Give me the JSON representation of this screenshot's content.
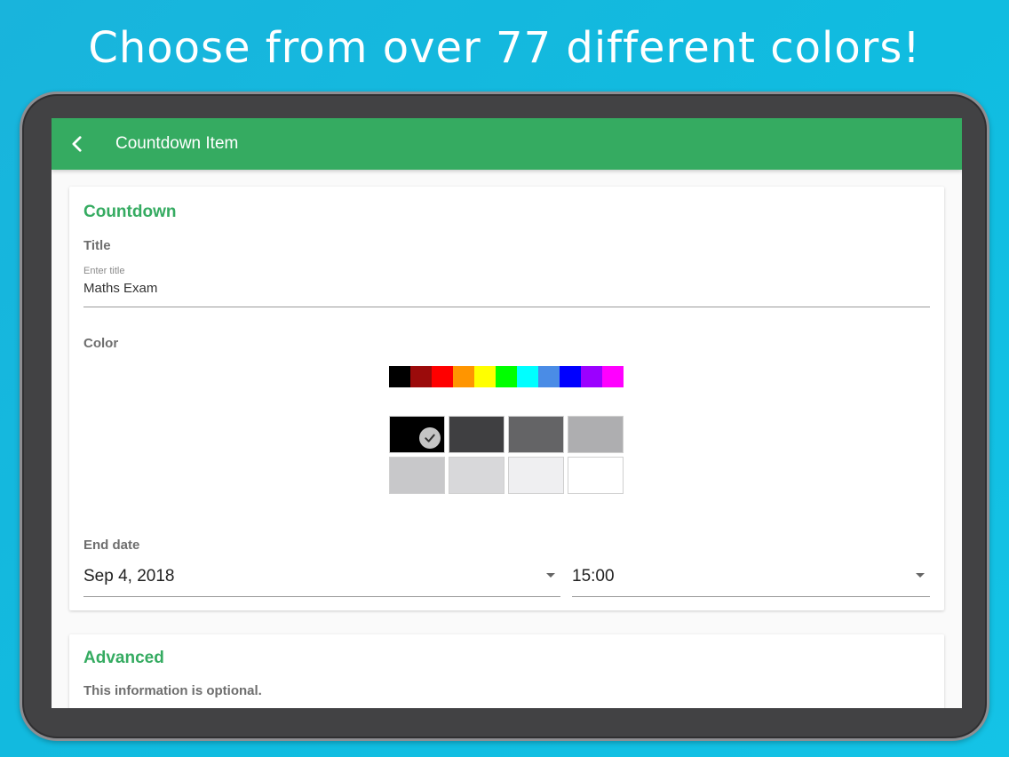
{
  "headline": "Choose from over 77 different colors!",
  "appbar": {
    "title": "Countdown Item",
    "back_icon": "chevron-left-icon"
  },
  "countdown_card": {
    "section_title": "Countdown",
    "title_label": "Title",
    "title_field": {
      "label": "Enter title",
      "value": "Maths Exam"
    },
    "color_label": "Color",
    "hue_colors": [
      "#000000",
      "#9b0b0b",
      "#ff0000",
      "#ff9500",
      "#ffff00",
      "#00ff00",
      "#00ffff",
      "#4a8ce6",
      "#0000ff",
      "#9b00ff",
      "#ff00ff"
    ],
    "shade_colors": [
      "#000000",
      "#3f3f41",
      "#646466",
      "#aeaeb0",
      "#c8c8ca",
      "#d8d8da",
      "#efeff1",
      "#ffffff"
    ],
    "selected_shade_index": 0,
    "end_date_label": "End date",
    "date_value": "Sep 4, 2018",
    "time_value": "15:00"
  },
  "advanced_card": {
    "section_title": "Advanced",
    "note": "This information is optional."
  }
}
